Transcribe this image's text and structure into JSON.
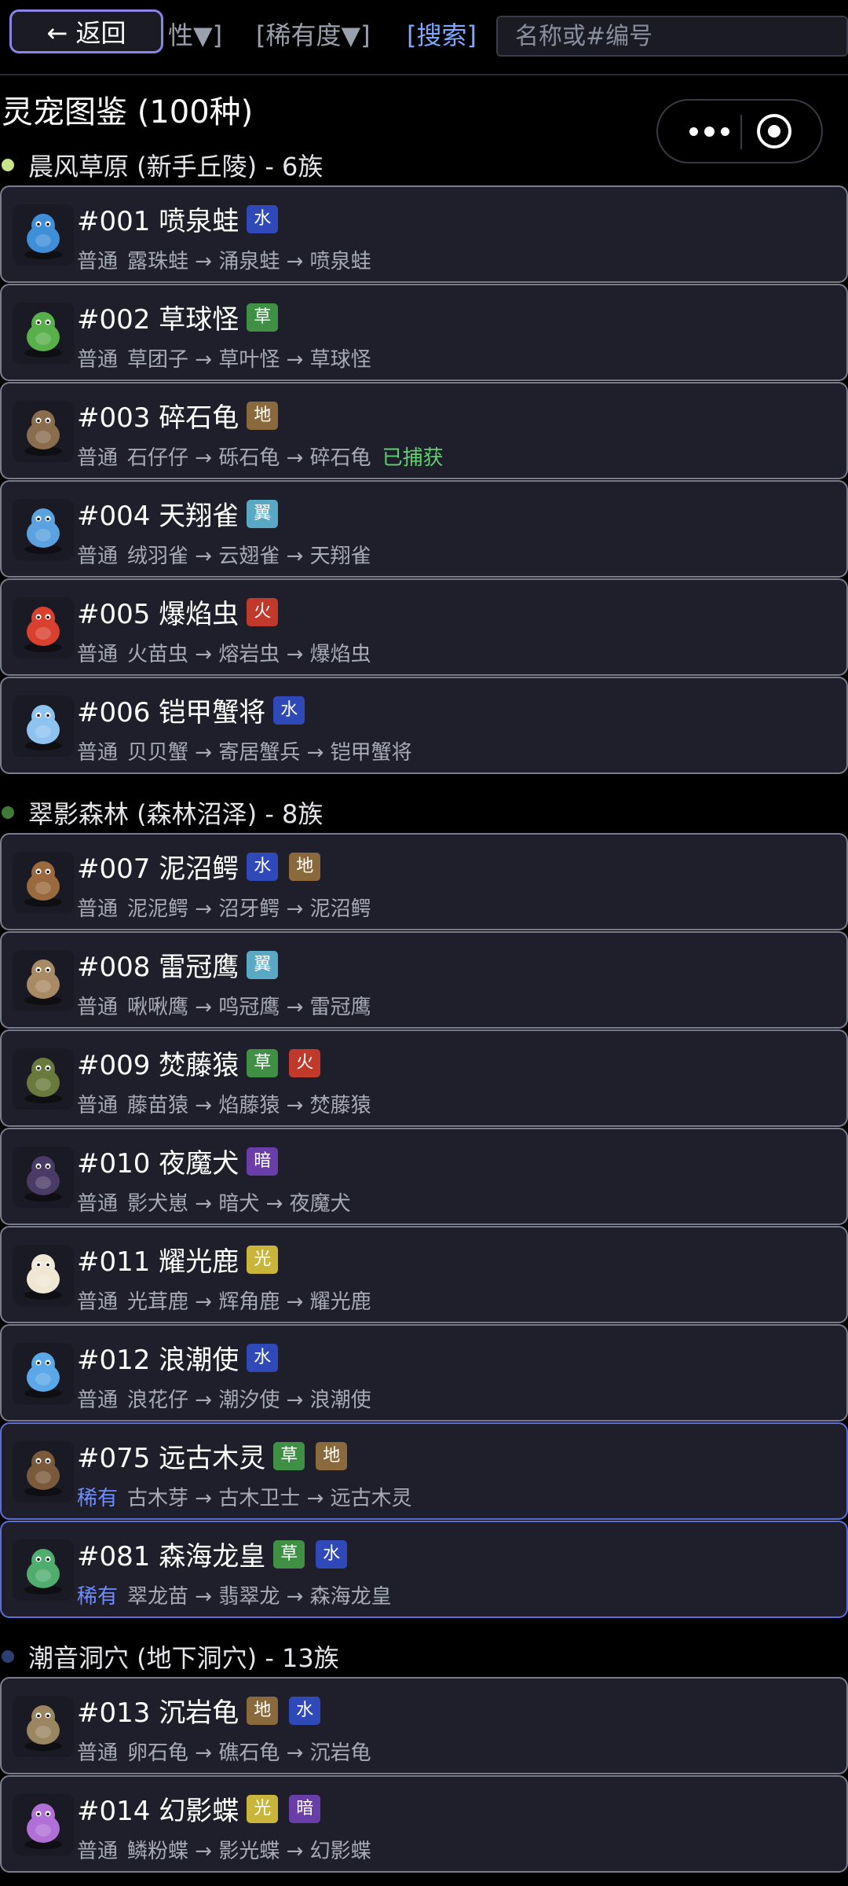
{
  "header": {
    "back_label": "← 返回",
    "filter_truncated": "性▼]",
    "filter_rarity": "[稀有度▼]",
    "search_label": "[搜索]",
    "search_placeholder": "名称或#编号",
    "search_value": ""
  },
  "page_title": "灵宠图鉴 (100种)",
  "colors": {
    "水": "#2f49b8",
    "草": "#3f8f45",
    "地": "#8a6a3c",
    "翼": "#5aa9c4",
    "火": "#c0392b",
    "暗": "#6a3ea8",
    "光": "#c8b53a",
    "rare_border": "#5b6fd6",
    "rare_text": "#6e8dff",
    "caught_text": "#5fcf6f"
  },
  "regions": [
    {
      "title": "晨风草原 (新手丘陵) - 6族",
      "dot": "#c7e68a",
      "pets": [
        {
          "title": "#001 喷泉蛙",
          "types": [
            "水"
          ],
          "rarity": "普通",
          "chain": "露珠蛙 → 涌泉蛙 → 喷泉蛙",
          "caught": "",
          "icon": "frog-icon",
          "tone": "#3f8ed8"
        },
        {
          "title": "#002 草球怪",
          "types": [
            "草"
          ],
          "rarity": "普通",
          "chain": "草团子 → 草叶怪 → 草球怪",
          "caught": "",
          "icon": "grass-ball-icon",
          "tone": "#58b04a"
        },
        {
          "title": "#003 碎石龟",
          "types": [
            "地"
          ],
          "rarity": "普通",
          "chain": "石仔仔 → 砾石龟 → 碎石龟",
          "caught": "已捕获",
          "icon": "turtle-icon",
          "tone": "#8a6d4d"
        },
        {
          "title": "#004 天翔雀",
          "types": [
            "翼"
          ],
          "rarity": "普通",
          "chain": "绒羽雀 → 云翅雀 → 天翔雀",
          "caught": "",
          "icon": "bird-icon",
          "tone": "#5aa2e0"
        },
        {
          "title": "#005 爆焰虫",
          "types": [
            "火"
          ],
          "rarity": "普通",
          "chain": "火苗虫 → 熔岩虫 → 爆焰虫",
          "caught": "",
          "icon": "fire-worm-icon",
          "tone": "#d9402e"
        },
        {
          "title": "#006 铠甲蟹将",
          "types": [
            "水"
          ],
          "rarity": "普通",
          "chain": "贝贝蟹 → 寄居蟹兵 → 铠甲蟹将",
          "caught": "",
          "icon": "crab-icon",
          "tone": "#8fc3ef"
        }
      ]
    },
    {
      "title": "翠影森林 (森林沼泽) - 8族",
      "dot": "#3f7a38",
      "pets": [
        {
          "title": "#007 泥沼鳄",
          "types": [
            "水",
            "地"
          ],
          "rarity": "普通",
          "chain": "泥泥鳄 → 沼牙鳄 → 泥沼鳄",
          "caught": "",
          "icon": "crocodile-icon",
          "tone": "#9a6a3e"
        },
        {
          "title": "#008 雷冠鹰",
          "types": [
            "翼"
          ],
          "rarity": "普通",
          "chain": "啾啾鹰 → 鸣冠鹰 → 雷冠鹰",
          "caught": "",
          "icon": "owl-icon",
          "tone": "#a88a64"
        },
        {
          "title": "#009 焚藤猿",
          "types": [
            "草",
            "火"
          ],
          "rarity": "普通",
          "chain": "藤苗猿 → 焰藤猿 → 焚藤猿",
          "caught": "",
          "icon": "monkey-icon",
          "tone": "#6a7a3c"
        },
        {
          "title": "#010 夜魔犬",
          "types": [
            "暗"
          ],
          "rarity": "普通",
          "chain": "影犬崽 → 暗犬 → 夜魔犬",
          "caught": "",
          "icon": "dark-dog-icon",
          "tone": "#4a3a66"
        },
        {
          "title": "#011 耀光鹿",
          "types": [
            "光"
          ],
          "rarity": "普通",
          "chain": "光茸鹿 → 辉角鹿 → 耀光鹿",
          "caught": "",
          "icon": "deer-icon",
          "tone": "#f0e6d4"
        },
        {
          "title": "#012 浪潮使",
          "types": [
            "水"
          ],
          "rarity": "普通",
          "chain": "浪花仔 → 潮汐使 → 浪潮使",
          "caught": "",
          "icon": "water-spirit-icon",
          "tone": "#5aa8e8"
        },
        {
          "title": "#075 远古木灵",
          "types": [
            "草",
            "地"
          ],
          "rarity": "稀有",
          "chain": "古木芽 → 古木卫士 → 远古木灵",
          "caught": "",
          "icon": "tree-spirit-icon",
          "tone": "#7a5a3a"
        },
        {
          "title": "#081 森海龙皇",
          "types": [
            "草",
            "水"
          ],
          "rarity": "稀有",
          "chain": "翠龙苗 → 翡翠龙 → 森海龙皇",
          "caught": "",
          "icon": "dragon-icon",
          "tone": "#4fae6e"
        }
      ]
    },
    {
      "title": "潮音洞穴 (地下洞穴) - 13族",
      "dot": "#2d3e73",
      "pets": [
        {
          "title": "#013 沉岩龟",
          "types": [
            "地",
            "水"
          ],
          "rarity": "普通",
          "chain": "卵石龟 → 礁石龟 → 沉岩龟",
          "caught": "",
          "icon": "rock-turtle-icon",
          "tone": "#9a8660"
        },
        {
          "title": "#014 幻影蝶",
          "types": [
            "光",
            "暗"
          ],
          "rarity": "普通",
          "chain": "鳞粉蝶 → 影光蝶 → 幻影蝶",
          "caught": "",
          "icon": "butterfly-icon",
          "tone": "#b070d8"
        }
      ]
    }
  ]
}
